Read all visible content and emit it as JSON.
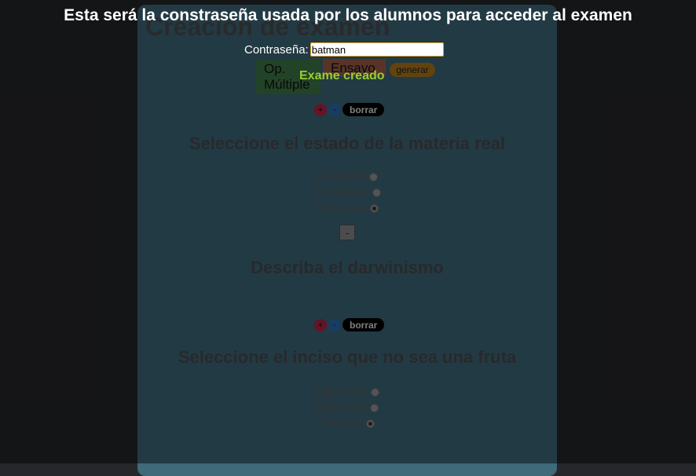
{
  "panel": {
    "title": "Creación de examen",
    "type_buttons": {
      "multiple": "Op. Múltiple",
      "essay": "Ensayo",
      "generate": "generar"
    },
    "controls": {
      "plus": "+",
      "minus": "-",
      "delete": "borrar"
    },
    "questions": [
      {
        "title": "Seleccione el estado de la materia real",
        "options": [
          {
            "label": "Revuelta",
            "checked": false
          },
          {
            "label": "Estrellada",
            "checked": false
          },
          {
            "label": "Gaseosa",
            "checked": true
          }
        ],
        "remove_label": "-"
      },
      {
        "title": "Describa el darwinismo"
      },
      {
        "title": "Seleccione el inciso que no sea una fruta",
        "options": [
          {
            "label": "Aguacate",
            "checked": false
          },
          {
            "label": "Manzana",
            "checked": false
          },
          {
            "label": "Cebolla",
            "checked": true
          }
        ]
      }
    ]
  },
  "modal": {
    "title": "Esta será la constraseña usada por los alumnos para acceder al examen",
    "password_label": "Contraseña:",
    "password_value": "batman",
    "status": "Exame creado"
  },
  "colors": {
    "status": "#9acd32",
    "panel": "#3e6a7a",
    "background": "#26272b"
  }
}
